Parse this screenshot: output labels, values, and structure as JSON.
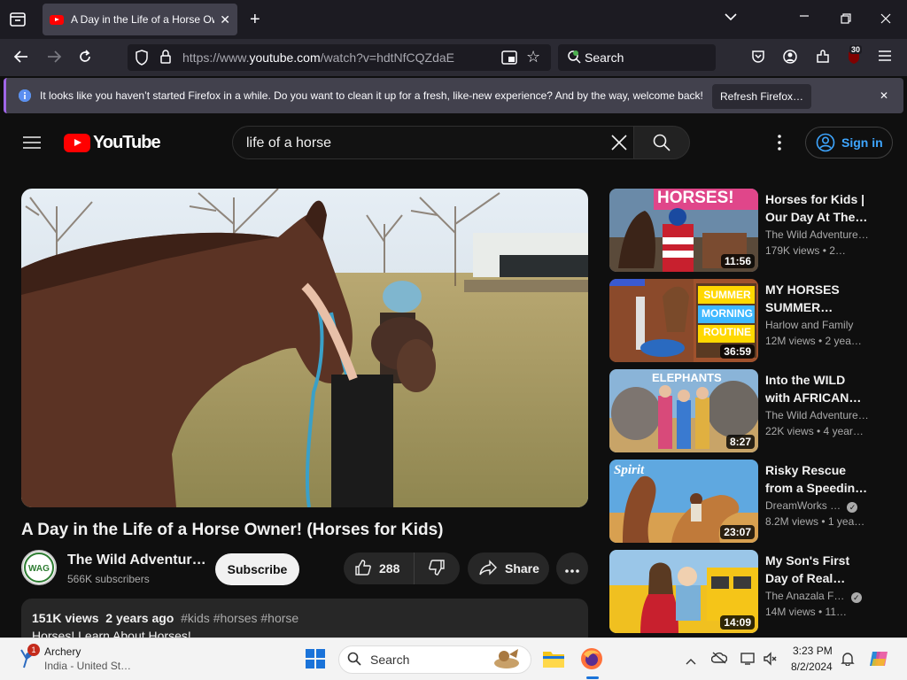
{
  "browser": {
    "tab_title": "A Day in the Life of a Horse Ow",
    "url_prefix": "https://www.",
    "url_host": "youtube.com",
    "url_path": "/watch?v=hdtNfCQZdaE",
    "search_placeholder": "Search",
    "extension_badge": "30"
  },
  "infobar": {
    "message": "It looks like you haven’t started Firefox in a while. Do you want to clean it up for a fresh, like-new experience? And by the way, welcome back!",
    "button_label": "Refresh Firefox…"
  },
  "youtube": {
    "logo_text": "YouTube",
    "search_value": "life of a horse",
    "signin_label": "Sign in",
    "video": {
      "title": "A Day in the Life of a Horse Owner! (Horses for Kids)",
      "channel": "The Wild Adventur…",
      "subscribers": "566K subscribers",
      "subscribe_label": "Subscribe",
      "likes": "288",
      "share_label": "Share",
      "views": "151K views",
      "age": "2 years ago",
      "tags": "#kids #horses #horse",
      "description": "Horses!  Learn About Horses!"
    },
    "recommendations": [
      {
        "title": "Horses for Kids | Our Day At The…",
        "channel": "The Wild Adventure…",
        "meta": "179K views  • 2…",
        "duration": "11:56",
        "thumb_text": "HORSES!"
      },
      {
        "title": "MY HORSES SUMMER…",
        "channel": "Harlow and Family",
        "meta": "12M views  • 2 yea…",
        "duration": "36:59",
        "thumb_text": "SUMMER MORNING ROUTINE"
      },
      {
        "title": "Into the WILD with AFRICAN…",
        "channel": "The Wild Adventure…",
        "meta": "22K views  • 4 year…",
        "duration": "8:27",
        "thumb_text": "ELEPHANTS"
      },
      {
        "title": "Risky Rescue from a Speedin…",
        "channel": "DreamWorks …",
        "meta": "8.2M views  • 1 yea…",
        "duration": "23:07",
        "thumb_text": "Spirit"
      },
      {
        "title": "My Son's First Day of Real…",
        "channel": "The Anazala F…",
        "meta": "14M views  • 11…",
        "duration": "14:09",
        "thumb_text": ""
      }
    ]
  },
  "taskbar": {
    "weather_title": "Archery",
    "weather_subtitle": "India - United St…",
    "weather_badge": "1",
    "search_placeholder": "Search",
    "time": "3:23 PM",
    "date": "8/2/2024"
  }
}
